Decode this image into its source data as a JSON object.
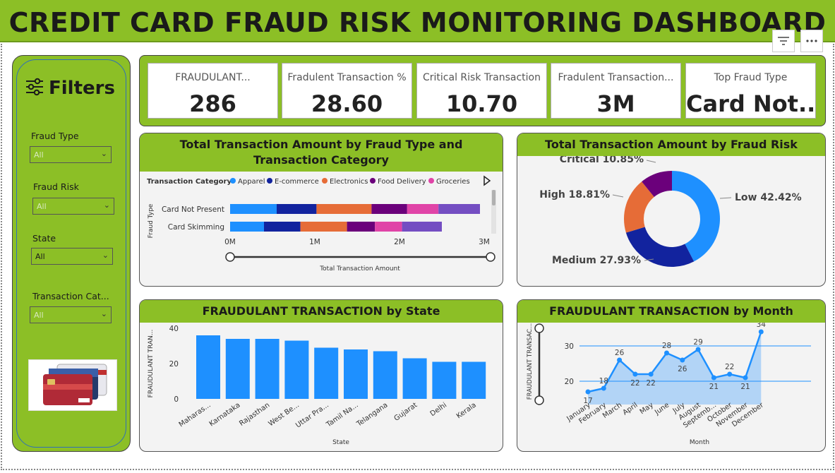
{
  "header": {
    "title": "CREDIT CARD FRAUD RISK MONITORING DASHBOARD"
  },
  "visual_icons": [
    "filter-icon",
    "more-options-icon"
  ],
  "filters": {
    "title": "Filters",
    "items": [
      {
        "label": "Fraud Type",
        "value": "All"
      },
      {
        "label": "Fraud Risk",
        "value": "All"
      },
      {
        "label": "State",
        "value": "All"
      },
      {
        "label": "Transaction Cat...",
        "value": "All"
      }
    ]
  },
  "kpis": [
    {
      "title": "FRAUDULANT...",
      "value": "286"
    },
    {
      "title": "Fradulent Transaction %",
      "value": "28.60"
    },
    {
      "title": "Critical Risk Transaction",
      "value": "10.70"
    },
    {
      "title": "Fradulent Transaction...",
      "value": "3M"
    },
    {
      "title": "Top Fraud Type",
      "value": "Card Not.."
    }
  ],
  "colors": {
    "accent_green": "#8cbf26",
    "bar_blue": "#1e90ff",
    "apparel": "#1e90ff",
    "ecommerce": "#12239e",
    "electronics": "#e66c37",
    "food_delivery": "#6b007b",
    "groceries": "#e044a7",
    "other": "#744ec2"
  },
  "chart_data": [
    {
      "type": "bar",
      "orientation": "horizontal-stacked",
      "title": "Total Transaction Amount by Fraud Type and Transaction Category",
      "legend_title": "Transaction Category",
      "legend": [
        "Apparel",
        "E-commerce",
        "Electronics",
        "Food Delivery",
        "Groceries"
      ],
      "categories": [
        "Card Not Present",
        "Card Skimming"
      ],
      "xlabel": "Total Transaction Amount",
      "ylabel": "Fraud Type",
      "xticks": [
        "0M",
        "1M",
        "2M",
        "3M"
      ],
      "xlim": [
        0,
        3
      ],
      "series": [
        {
          "name": "Apparel",
          "values": [
            0.55,
            0.4
          ]
        },
        {
          "name": "E-commerce",
          "values": [
            0.47,
            0.43
          ]
        },
        {
          "name": "Electronics",
          "values": [
            0.65,
            0.55
          ]
        },
        {
          "name": "Food Delivery",
          "values": [
            0.42,
            0.33
          ]
        },
        {
          "name": "Groceries",
          "values": [
            0.37,
            0.32
          ]
        },
        {
          "values": [
            0.49,
            0.47
          ]
        }
      ]
    },
    {
      "type": "pie",
      "subtype": "donut",
      "title": "Total Transaction Amount by Fraud Risk",
      "slices": [
        {
          "label": "Low 42.42%",
          "value": 42.42,
          "color": "#1e90ff"
        },
        {
          "label": "Medium 27.93%",
          "value": 27.93,
          "color": "#12239e"
        },
        {
          "label": "High 18.81%",
          "value": 18.81,
          "color": "#e66c37"
        },
        {
          "label": "Critical 10.85%",
          "value": 10.85,
          "color": "#6b007b"
        }
      ]
    },
    {
      "type": "bar",
      "title": "FRAUDULANT TRANSACTION by State",
      "categories": [
        "Maharas...",
        "Karnataka",
        "Rajasthan",
        "West Be...",
        "Uttar Pra...",
        "Tamil Na...",
        "Telangana",
        "Gujarat",
        "Delhi",
        "Kerala"
      ],
      "values": [
        36,
        34,
        34,
        33,
        29,
        28,
        27,
        23,
        21,
        21
      ],
      "xlabel": "State",
      "ylabel": "FRAUDULANT TRAN...",
      "ylim": [
        0,
        40
      ],
      "yticks": [
        0,
        20,
        40
      ]
    },
    {
      "type": "area",
      "title": "FRAUDULANT TRANSACTION by Month",
      "categories": [
        "January",
        "February",
        "March",
        "April",
        "May",
        "June",
        "July",
        "August",
        "Septemb...",
        "October",
        "November",
        "December"
      ],
      "values": [
        17,
        18,
        26,
        22,
        22,
        28,
        26,
        29,
        21,
        22,
        21,
        34
      ],
      "xlabel": "Month",
      "ylabel": "FRAUDULANT TRANSAC...",
      "ylim": [
        15,
        35
      ],
      "yticks": [
        20,
        30
      ]
    }
  ]
}
